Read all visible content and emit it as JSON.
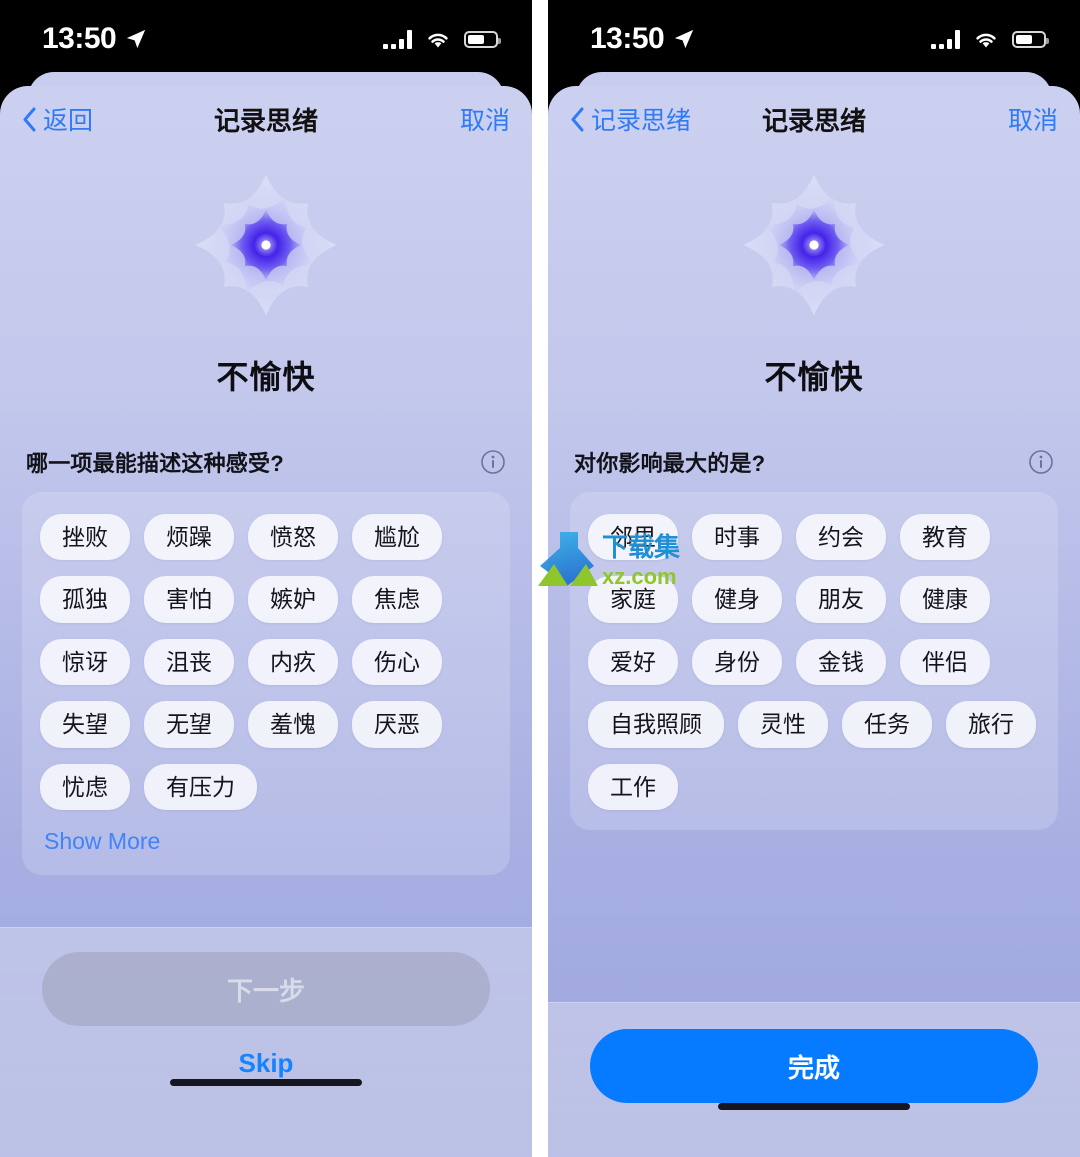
{
  "statusbar": {
    "time": "13:50",
    "location_icon": "location-arrow-icon",
    "signal_icon": "cellular-signal-icon",
    "wifi_icon": "wifi-icon",
    "battery_icon": "battery-icon",
    "battery_level": 62
  },
  "colors": {
    "accent_blue": "#077bff",
    "link_blue": "#2f7bf6",
    "sheet_top": "#ccd0f0",
    "sheet_bottom": "#9ba4dd",
    "chip_bg": "#ffffffc7",
    "text_primary": "#12121a"
  },
  "left_screen": {
    "nav": {
      "back_label": "返回",
      "back_icon": "chevron-left-icon",
      "title": "记录思绪",
      "cancel_label": "取消"
    },
    "mood": {
      "icon": "mood-flower-icon",
      "label": "不愉快"
    },
    "question": {
      "text": "哪一项最能描述这种感受?",
      "info_icon": "info-circle-icon"
    },
    "chips": [
      "挫败",
      "烦躁",
      "愤怒",
      "尴尬",
      "孤独",
      "害怕",
      "嫉妒",
      "焦虑",
      "惊讶",
      "沮丧",
      "内疚",
      "伤心",
      "失望",
      "无望",
      "羞愧",
      "厌恶",
      "忧虑",
      "有压力"
    ],
    "show_more_label": "Show More",
    "footer": {
      "primary_label": "下一步",
      "primary_disabled": true,
      "skip_label": "Skip"
    }
  },
  "right_screen": {
    "nav": {
      "back_label": "记录思绪",
      "back_icon": "chevron-left-icon",
      "title": "记录思绪",
      "cancel_label": "取消"
    },
    "mood": {
      "icon": "mood-flower-icon",
      "label": "不愉快"
    },
    "question": {
      "text": "对你影响最大的是?",
      "info_icon": "info-circle-icon"
    },
    "chips": [
      "邻里",
      "时事",
      "约会",
      "教育",
      "家庭",
      "健身",
      "朋友",
      "健康",
      "爱好",
      "身份",
      "金钱",
      "伴侣",
      "自我照顾",
      "灵性",
      "任务",
      "旅行",
      "工作"
    ],
    "footer": {
      "primary_label": "完成",
      "primary_disabled": false
    }
  },
  "watermark": {
    "logo_icon": "download-arrow-logo-icon",
    "text_top": "下载集",
    "text_bottom": "xz.com"
  }
}
